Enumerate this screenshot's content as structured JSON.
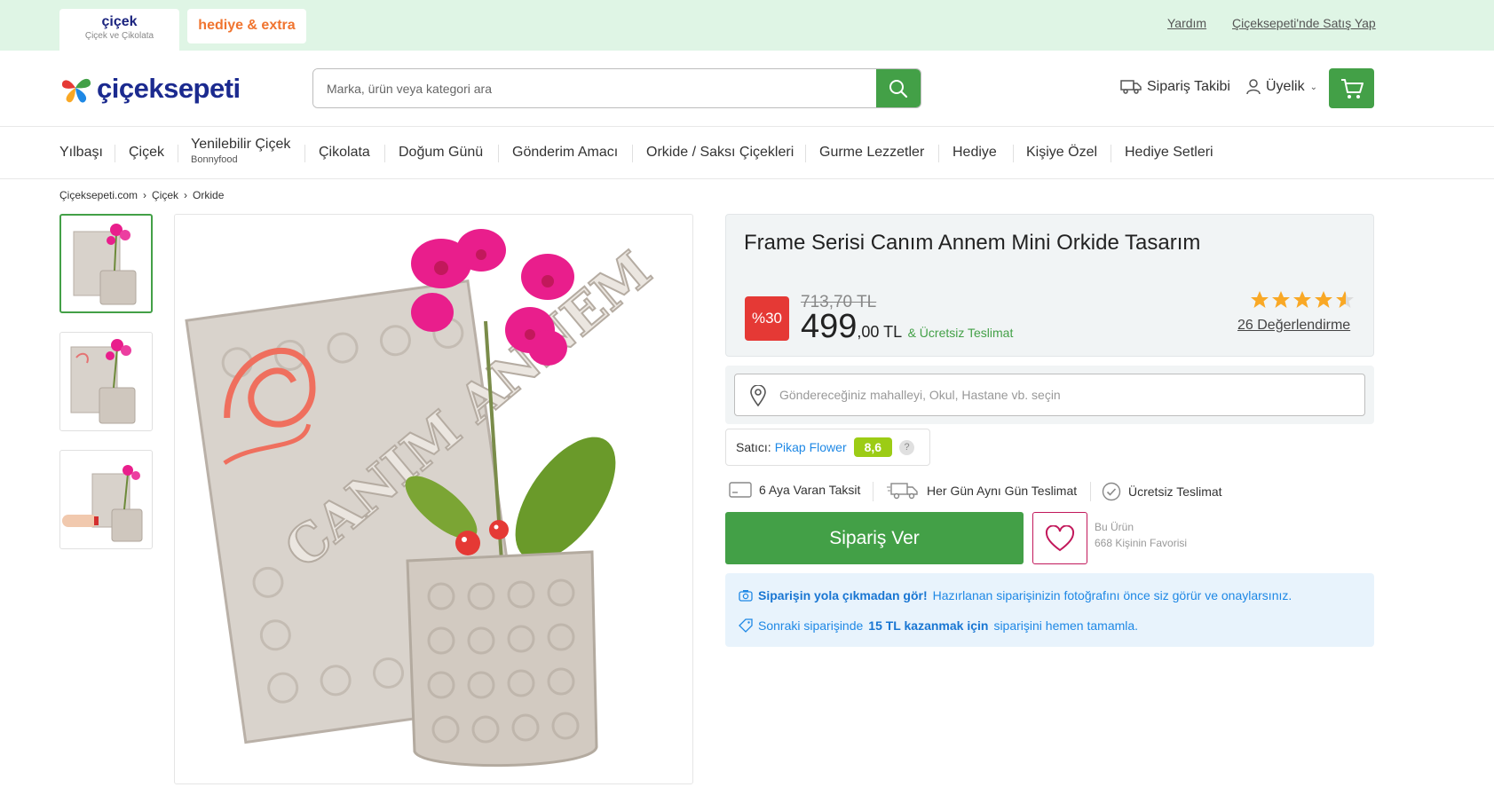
{
  "topbar": {
    "tabs": [
      {
        "label": "çiçek",
        "sub": "Çiçek ve Çikolata"
      },
      {
        "label": "hediye & extra"
      }
    ],
    "links": [
      "Yardım",
      "Çiçeksepeti'nde Satış Yap"
    ]
  },
  "header": {
    "logo_text": "çiçeksepeti",
    "search_placeholder": "Marka, ürün veya kategori ara",
    "order_tracking": "Sipariş Takibi",
    "membership": "Üyelik",
    "icons": {
      "search": "search-icon",
      "truck": "truck-icon",
      "user": "user-icon",
      "cart": "cart-icon"
    }
  },
  "nav": [
    {
      "label": "Yılbaşı"
    },
    {
      "label": "Çiçek"
    },
    {
      "label": "Yenilebilir Çiçek",
      "sub": "Bonnyfood"
    },
    {
      "label": "Çikolata"
    },
    {
      "label": "Doğum Günü"
    },
    {
      "label": "Gönderim Amacı"
    },
    {
      "label": "Orkide / Saksı Çiçekleri"
    },
    {
      "label": "Gurme Lezzetler"
    },
    {
      "label": "Hediye"
    },
    {
      "label": "Kişiye Özel"
    },
    {
      "label": "Hediye Setleri"
    }
  ],
  "breadcrumb": [
    "Çiçeksepeti.com",
    "Çiçek",
    "Orkide"
  ],
  "product": {
    "title": "Frame Serisi Canım Annem Mini Orkide Tasarım",
    "discount": "%30",
    "old_price": "713,70 TL",
    "price_main": "499",
    "price_fraction": ",00 TL",
    "free_delivery": "& Ücretsiz Teslimat",
    "rating": 4.5,
    "reviews": "26 Değerlendirme",
    "image_text": "CANIM ANNEM"
  },
  "location": {
    "placeholder": "Göndereceğiniz mahalleyi, Okul, Hastane vb. seçin"
  },
  "seller": {
    "label": "Satıcı:",
    "name": "Pikap Flower",
    "score": "8,6",
    "help": "?"
  },
  "features": [
    "6 Aya Varan Taksit",
    "Her Gün Aynı Gün Teslimat",
    "Ücretsiz Teslimat"
  ],
  "order_button": "Sipariş Ver",
  "favorite": {
    "line1": "Bu Ürün",
    "line2": "668 Kişinin Favorisi"
  },
  "promo": {
    "line1_bold": "Siparişin yola çıkmadan gör!",
    "line1_rest": "Hazırlanan siparişinizin fotoğrafını önce siz görür ve onaylarsınız.",
    "line2_a": "Sonraki siparişinde",
    "line2_bold": "15 TL kazanmak için",
    "line2_b": "siparişini hemen tamamla."
  },
  "colors": {
    "brand_green": "#43a047",
    "brand_navy": "#1b2a8f",
    "discount_red": "#e53935",
    "star": "#f9a825",
    "link_blue": "#1e88e5"
  }
}
